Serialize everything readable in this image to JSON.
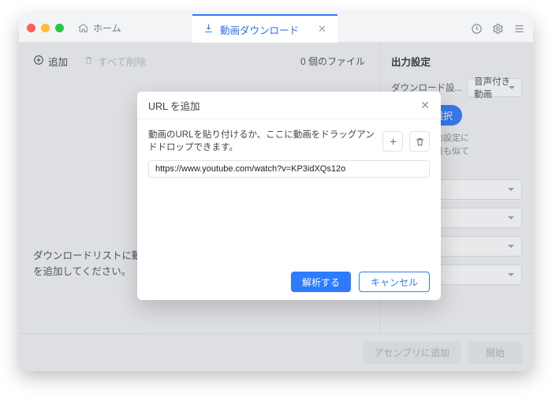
{
  "titlebar": {
    "home_label": "ホーム",
    "tab_label": "動画ダウンロード"
  },
  "toolbar": {
    "add_label": "追加",
    "delete_all_label": "すべて削除",
    "file_count": "0 個のファイル"
  },
  "empty": {
    "line1": "ダウンロードリストに動",
    "line2": "を追加してください。"
  },
  "side": {
    "title": "出力設定",
    "download_setting_label": "ダウンロード設...",
    "download_setting_value": "音声付き動画",
    "manual_select": "手動選択",
    "note": "能な限り手動設定に\nい場合は、最も似て\nされます。"
  },
  "footer": {
    "add_assembly": "アセンブリに追加",
    "start": "開始"
  },
  "modal": {
    "title": "URL を追加",
    "instruction": "動画のURLを貼り付けるか、ここに動画をドラッグアンドドロップできます。",
    "url_value": "https://www.youtube.com/watch?v=KP3idXQs12o",
    "analyze": "解析する",
    "cancel": "キャンセル"
  }
}
